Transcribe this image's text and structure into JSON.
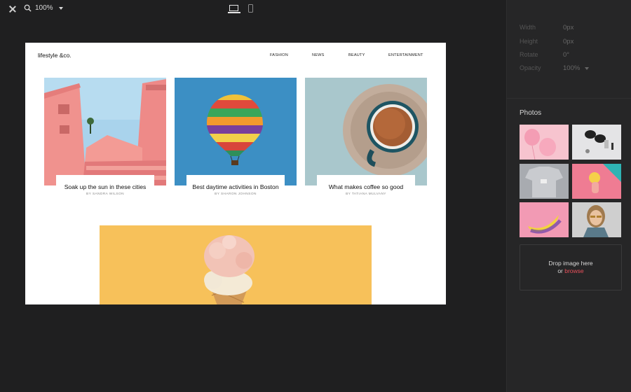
{
  "toolbar": {
    "zoom_value": "100%"
  },
  "preview": {
    "logo": "lifestyle &co.",
    "nav": [
      "FASHION",
      "NEWS",
      "BEAUTY",
      "ENTERTAINMENT"
    ],
    "cards": [
      {
        "title": "Soak up the sun in these cities",
        "author": "BY SANDRA WILSON"
      },
      {
        "title": "Best daytime activities in Boston",
        "author": "BY SHARON JOHNSON"
      },
      {
        "title": "What makes coffee so good",
        "author": "BY TATIANA MULVANY"
      }
    ]
  },
  "properties": [
    {
      "label": "Width",
      "value": "0px"
    },
    {
      "label": "Height",
      "value": "0px"
    },
    {
      "label": "Rotate",
      "value": "0°"
    },
    {
      "label": "Opacity",
      "value": "100%"
    }
  ],
  "photos": {
    "title": "Photos",
    "dropzone": {
      "line1": "Drop image here",
      "or": "or ",
      "browse": "browse"
    }
  },
  "colors": {
    "accent": "#e8505b",
    "panel_bg": "#262627",
    "workspace_bg": "#1f1f20"
  },
  "icons": [
    "close-icon",
    "zoom-icon",
    "caret-down-icon",
    "desktop-device-icon",
    "mobile-device-icon"
  ]
}
